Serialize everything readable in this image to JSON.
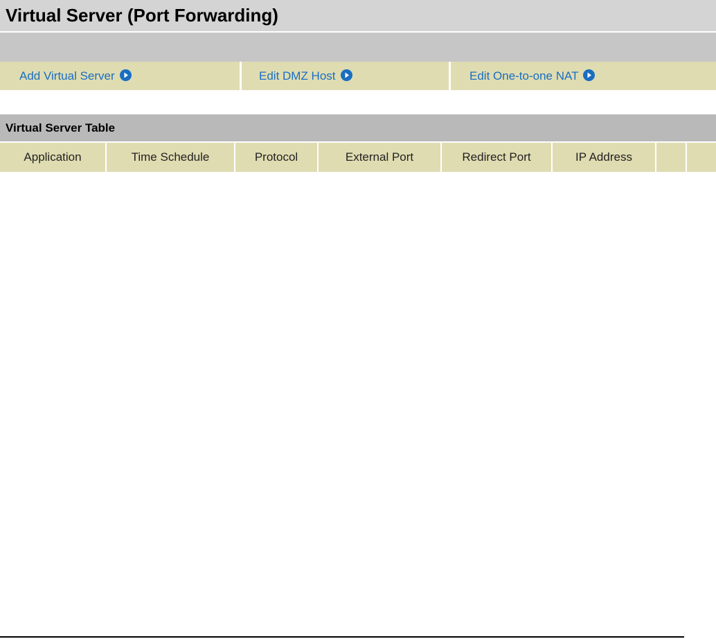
{
  "page": {
    "title": "Virtual Server (Port Forwarding)"
  },
  "links": {
    "add_virtual_server": "Add Virtual Server",
    "edit_dmz_host": "Edit DMZ Host",
    "edit_one_to_one_nat": "Edit One-to-one NAT",
    "icon": "circle-arrow-right-icon",
    "link_color": "#1a6ec2"
  },
  "table": {
    "title": "Virtual Server Table",
    "columns": [
      "Application",
      "Time Schedule",
      "Protocol",
      "External Port",
      "Redirect Port",
      "IP Address",
      "",
      ""
    ],
    "rows": []
  },
  "colors": {
    "title_bg": "#d4d4d4",
    "bar_bg": "#c6c6c6",
    "cell_bg": "#dfdcb1",
    "section_bg": "#b9b9b9"
  }
}
